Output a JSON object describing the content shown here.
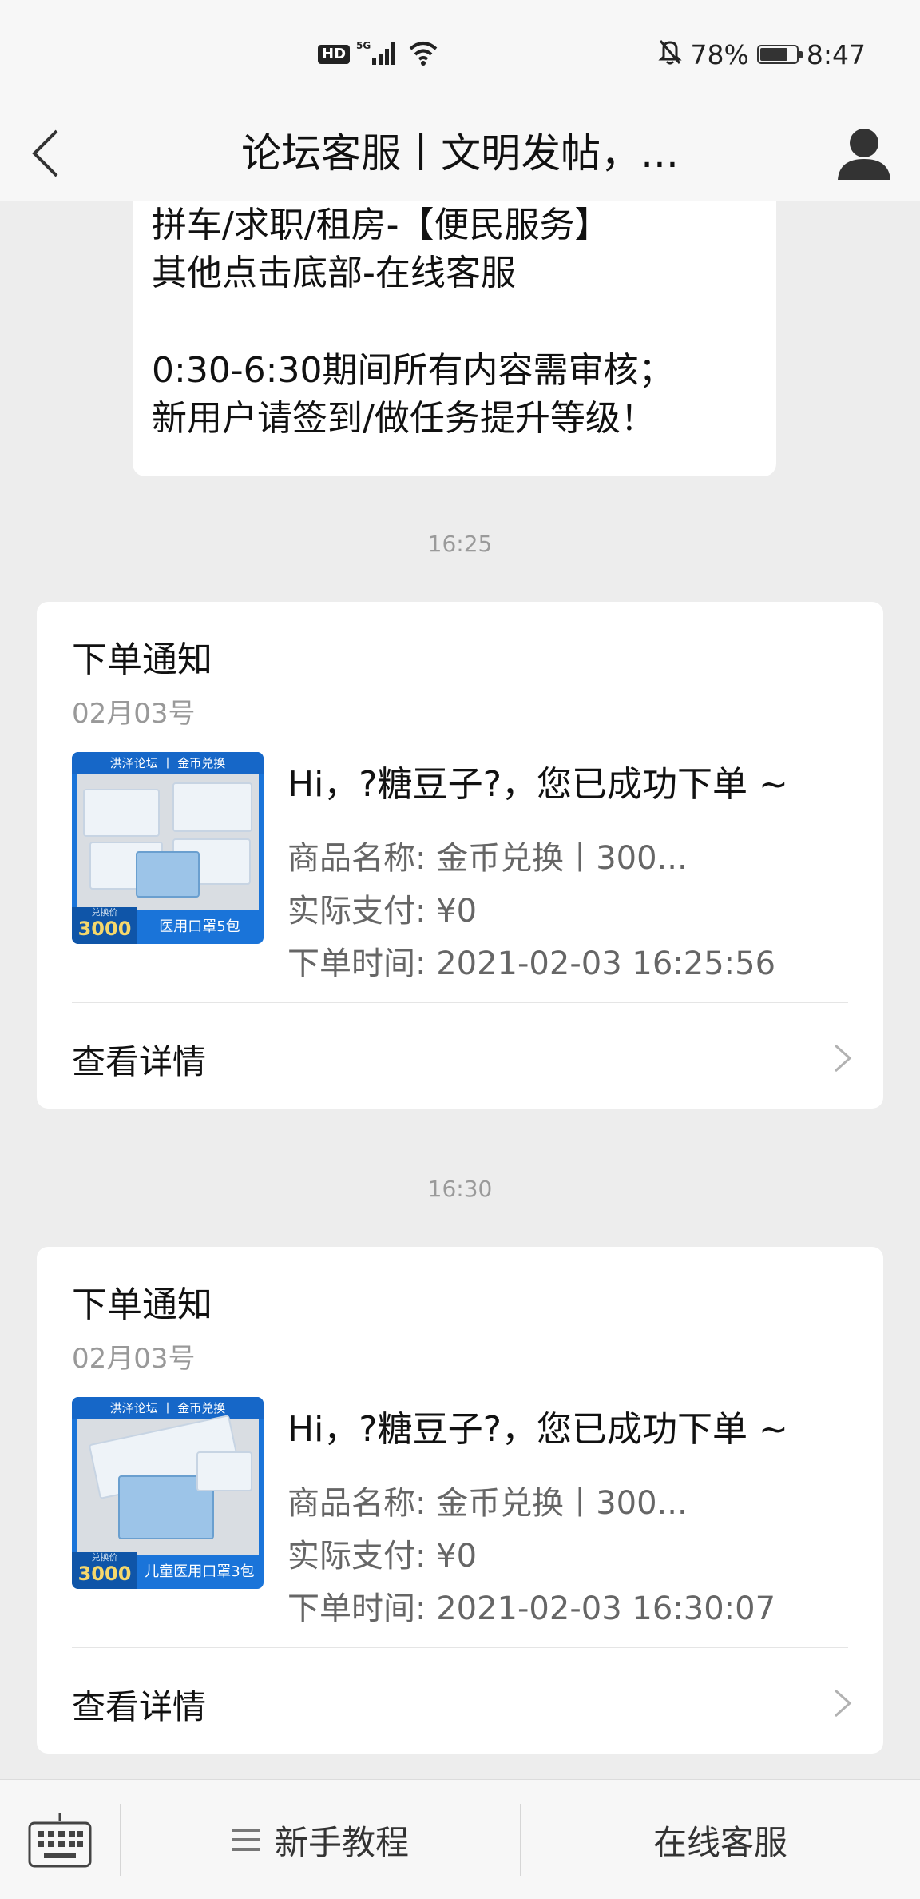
{
  "status_bar": {
    "hd": "HD",
    "network": "5G",
    "battery_percent": "78%",
    "battery_level": 0.78,
    "time": "8:47",
    "icons": [
      "signal-icon",
      "wifi-icon",
      "mute-bell-icon",
      "battery-icon"
    ]
  },
  "header": {
    "title": "论坛客服丨文明发帖，...",
    "back_icon": "chevron-left-icon",
    "profile_icon": "user-icon"
  },
  "chat": {
    "welcome_lines": [
      "拼车/求职/租房-【便民服务】",
      "其他点击底部-在线客服",
      "0:30-6:30期间所有内容需审核；",
      "新用户请签到/做任务提升等级！"
    ],
    "messages": [
      {
        "time": "16:25",
        "title": "下单通知",
        "date": "02月03号",
        "thumb": {
          "banner": "洪泽论坛 丨 金币兑换",
          "price_tag": "兑换价",
          "price": "3000",
          "product": "医用口罩5包"
        },
        "headline": "Hi，?糖豆子?，您已成功下单 ~",
        "product_line": "商品名称: 金币兑换丨300...",
        "payment_line": "实际支付: ¥0",
        "order_time_line": "下单时间: 2021-02-03 16:25:56",
        "detail_label": "查看详情"
      },
      {
        "time": "16:30",
        "title": "下单通知",
        "date": "02月03号",
        "thumb": {
          "banner": "洪泽论坛 丨 金币兑换",
          "price_tag": "兑换价",
          "price": "3000",
          "product": "儿童医用口罩3包"
        },
        "headline": "Hi，?糖豆子?，您已成功下单 ~",
        "product_line": "商品名称: 金币兑换丨300...",
        "payment_line": "实际支付: ¥0",
        "order_time_line": "下单时间: 2021-02-03 16:30:07",
        "detail_label": "查看详情"
      }
    ]
  },
  "bottom_bar": {
    "keyboard_icon": "keyboard-icon",
    "menu_icon": "menu-icon",
    "tutorial_label": "新手教程",
    "service_label": "在线客服"
  }
}
